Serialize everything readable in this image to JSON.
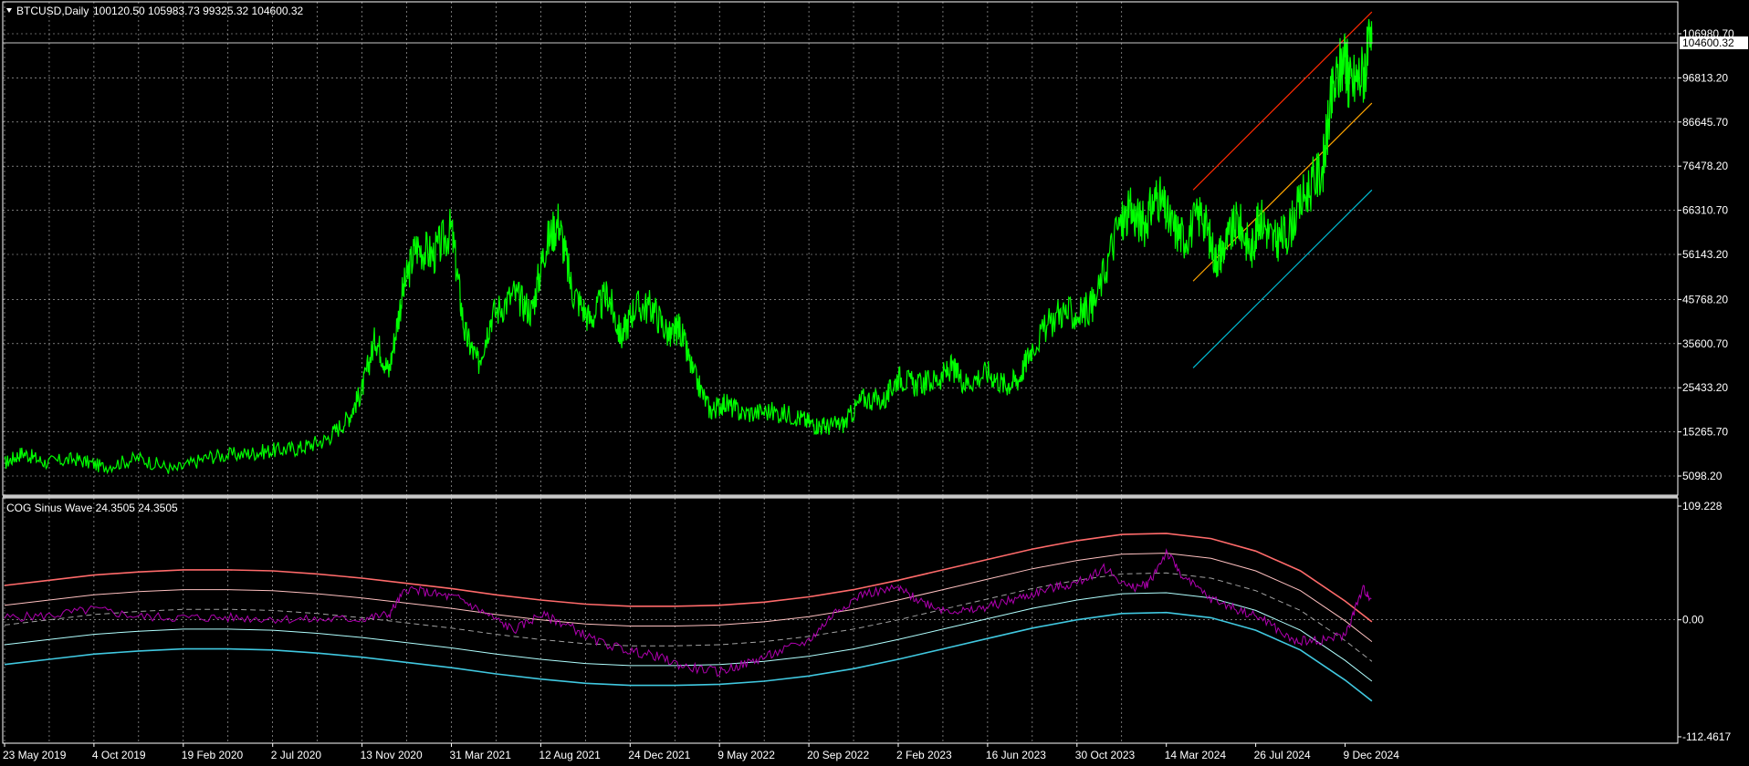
{
  "window": {
    "symbol_line": "BTCUSD,Daily",
    "ohlc_line": "100120.50 105983.73 99325.32 104600.32",
    "indicator_line": "COG Sinus Wave 24.3505 24.3505",
    "current_price_tag": "104600.32"
  },
  "colors": {
    "background": "#000000",
    "grid": "#c0c0c0",
    "price_series": "#00ff00",
    "channel_top": "#ff2a00",
    "channel_mid": "#ffa500",
    "channel_bottom": "#00bcd4",
    "oscillator": "#b000b0",
    "band_outer_upper": "#ff6a6a",
    "band_inner_upper": "#ffc0c0",
    "band_center": "#a0a0a0",
    "band_inner_lower": "#b0ffff",
    "band_outer_lower": "#40c8e0"
  },
  "chart_data": [
    {
      "type": "line",
      "name": "BTCUSD,Daily",
      "x_ticks": [
        "23 May 2019",
        "4 Oct 2019",
        "19 Feb 2020",
        "2 Jul 2020",
        "13 Nov 2020",
        "31 Mar 2021",
        "12 Aug 2021",
        "24 Dec 2021",
        "9 May 2022",
        "20 Sep 2022",
        "2 Feb 2023",
        "16 Jun 2023",
        "30 Oct 2023",
        "14 Mar 2024",
        "26 Jul 2024",
        "9 Dec 2024"
      ],
      "x_tick_index": [
        0,
        1,
        2,
        3,
        4,
        5,
        6,
        7,
        8,
        9,
        10,
        11,
        12,
        13,
        14,
        15
      ],
      "y_ticks": [
        "106980.70",
        "96813.20",
        "86645.70",
        "76478.20",
        "66310.70",
        "56143.20",
        "45768.20",
        "35600.70",
        "25433.20",
        "15265.70",
        "5098.20"
      ],
      "y_tick_values": [
        106980.7,
        96813.2,
        86645.7,
        76478.2,
        66310.7,
        56143.2,
        45768.2,
        35600.7,
        25433.2,
        15265.7,
        5098.2
      ],
      "ylim": [
        1000,
        112000
      ],
      "x": [
        0,
        0.2,
        0.45,
        0.8,
        1.1,
        1.5,
        1.9,
        2.3,
        2.7,
        3.0,
        3.3,
        3.6,
        3.85,
        4.0,
        4.15,
        4.3,
        4.45,
        4.6,
        4.8,
        5.0,
        5.15,
        5.3,
        5.45,
        5.7,
        5.9,
        6.05,
        6.2,
        6.35,
        6.55,
        6.75,
        6.9,
        7.05,
        7.25,
        7.45,
        7.55,
        7.7,
        7.9,
        8.05,
        8.25,
        8.55,
        8.85,
        9.05,
        9.2,
        9.4,
        9.6,
        9.85,
        10.0,
        10.2,
        10.45,
        10.6,
        10.75,
        11.0,
        11.2,
        11.35,
        11.5,
        11.8,
        12.0,
        12.2,
        12.45,
        12.6,
        12.75,
        12.9,
        13.05,
        13.2,
        13.4,
        13.55,
        13.65,
        13.8,
        13.95,
        14.05,
        14.2,
        14.35,
        14.55,
        14.75,
        14.85,
        15.0,
        15.05,
        15.2,
        15.3
      ],
      "series": [
        {
          "name": "BTCUSD,Daily",
          "values": [
            8000,
            10500,
            8200,
            9000,
            7200,
            9200,
            6500,
            9600,
            10200,
            11000,
            11500,
            13500,
            18500,
            25000,
            37000,
            29000,
            47000,
            58000,
            56000,
            62000,
            38000,
            31000,
            42000,
            47000,
            43000,
            58000,
            64000,
            48000,
            41000,
            47000,
            37000,
            44000,
            44000,
            37000,
            39500,
            29000,
            20000,
            22000,
            19500,
            20000,
            19000,
            17000,
            16500,
            17200,
            23000,
            22500,
            28000,
            26000,
            27500,
            30000,
            26500,
            29000,
            26000,
            27500,
            35000,
            43000,
            42000,
            45000,
            62000,
            66000,
            63000,
            70000,
            63000,
            60000,
            66000,
            55000,
            58000,
            64000,
            57000,
            65000,
            59000,
            61000,
            70000,
            76000,
            92000,
            103000,
            95000,
            98000,
            104600
          ]
        }
      ],
      "trend_channel": {
        "top": [
          [
            13.3,
            71000
          ],
          [
            15.3,
            112000
          ]
        ],
        "middle": [
          [
            13.3,
            50000
          ],
          [
            15.3,
            91000
          ]
        ],
        "bottom": [
          [
            13.3,
            30000
          ],
          [
            15.3,
            71000
          ]
        ]
      },
      "current_value": 104600.32
    },
    {
      "type": "line",
      "name": "COG Sinus Wave",
      "y_ticks": [
        "109.228",
        "0.00",
        "-112.4617"
      ],
      "y_tick_values": [
        109.228,
        0.0,
        -112.4617
      ],
      "ylim": [
        -112.4617,
        109.228
      ],
      "x": [
        0,
        0.5,
        1.0,
        1.5,
        2.0,
        2.5,
        3.0,
        3.5,
        4.0,
        4.3,
        4.5,
        4.8,
        5.1,
        5.4,
        5.7,
        6.0,
        6.3,
        6.6,
        7.0,
        7.3,
        7.6,
        8.0,
        8.3,
        8.6,
        9.0,
        9.3,
        9.6,
        10.0,
        10.2,
        10.5,
        10.8,
        11.1,
        11.4,
        11.7,
        12.0,
        12.3,
        12.6,
        12.8,
        13.0,
        13.2,
        13.5,
        13.8,
        14.1,
        14.4,
        14.7,
        15.0,
        15.2,
        15.3
      ],
      "series": [
        {
          "name": "COG Sinus Wave",
          "values": [
            2,
            4,
            10,
            3,
            2,
            2,
            1,
            0,
            1,
            5,
            30,
            25,
            20,
            5,
            -10,
            5,
            -5,
            -20,
            -30,
            -35,
            -45,
            -50,
            -42,
            -33,
            -20,
            8,
            25,
            30,
            20,
            10,
            8,
            15,
            22,
            30,
            35,
            50,
            30,
            35,
            65,
            40,
            20,
            10,
            0,
            -20,
            -20,
            -15,
            30,
            20
          ]
        }
      ],
      "bands": {
        "x": [
          0,
          0.5,
          1.0,
          1.5,
          2.0,
          2.5,
          3.0,
          3.5,
          4.0,
          4.5,
          5.0,
          5.5,
          6.0,
          6.5,
          7.0,
          7.5,
          8.0,
          8.5,
          9.0,
          9.5,
          10.0,
          10.5,
          11.0,
          11.5,
          12.0,
          12.5,
          13.0,
          13.5,
          14.0,
          14.5,
          15.0,
          15.3
        ],
        "center": [
          -5,
          0,
          5,
          8,
          10,
          10,
          9,
          6,
          2,
          -3,
          -8,
          -14,
          -19,
          -23,
          -25,
          -25,
          -24,
          -21,
          -16,
          -9,
          0,
          10,
          20,
          30,
          38,
          44,
          45,
          40,
          28,
          9,
          -20,
          -40
        ],
        "offsets": [
          38,
          19,
          -19,
          -38
        ]
      }
    }
  ]
}
